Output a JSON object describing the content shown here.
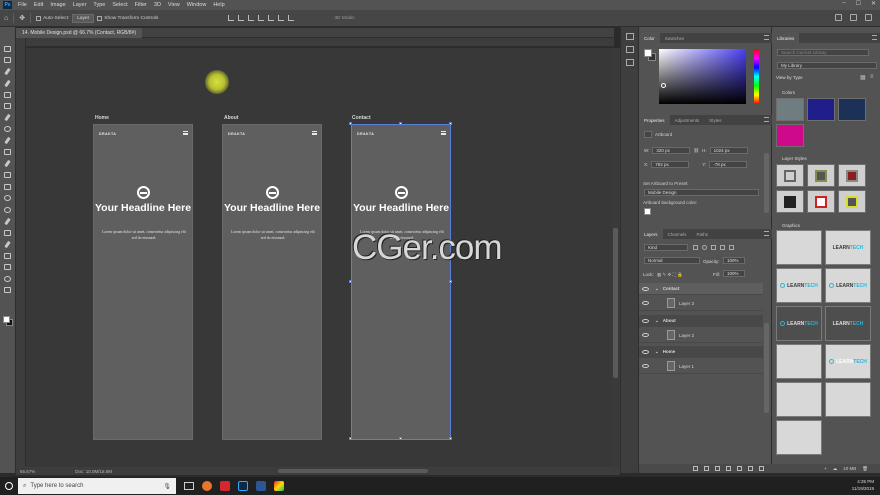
{
  "menubar": {
    "items": [
      "File",
      "Edit",
      "Image",
      "Layer",
      "Type",
      "Select",
      "Filter",
      "3D",
      "View",
      "Window",
      "Help"
    ]
  },
  "options": {
    "auto_select": "Auto-Select:",
    "auto_select_target": "Layer",
    "transform_controls": "Show Transform Controls",
    "mode_3d": "3D Mode:"
  },
  "document": {
    "tab_title": "14. Mobile Design.psd @ 66.7% (Contact, RGB/8#)",
    "zoom": "66.67%",
    "doc_size": "Doc: 10.0M/16.6M"
  },
  "artboards": [
    {
      "title": "Home",
      "brand": "DRAKTA",
      "headline": "Your Headline Here",
      "body": "Lorem ipsum dolor sit amet, consectetur adipiscing elit sed do eiusmod."
    },
    {
      "title": "About",
      "brand": "DRAKTA",
      "headline": "Your Headline Here",
      "body": "Lorem ipsum dolor sit amet, consectetur adipiscing elit sed do eiusmod."
    },
    {
      "title": "Contact",
      "brand": "DRAKTA",
      "headline": "Your Headline Here",
      "body": "Lorem ipsum dolor sit amet, consectetur adipiscing elit sed do eiusmod."
    }
  ],
  "watermark": "CGer.com",
  "color_panel": {
    "tabs": [
      "Color",
      "Swatches"
    ]
  },
  "properties_panel": {
    "tabs": [
      "Properties",
      "Adjustments",
      "Styles"
    ],
    "type_label": "Artboard",
    "w": "320 px",
    "h": "1024 px",
    "x": "792 px",
    "y": "-78 px",
    "w_label": "W:",
    "h_label": "H:",
    "x_label": "X:",
    "y_label": "Y:",
    "go_label": "GO",
    "preset_label": "Set Artboard to Preset:",
    "preset_value": "Mobile Design",
    "bg_label": "Artboard background color:"
  },
  "layers_panel": {
    "tabs": [
      "Layers",
      "Channels",
      "Paths"
    ],
    "kind": "Kind",
    "blend_mode": "Normal",
    "opacity_label": "Opacity:",
    "opacity": "100%",
    "lock_label": "Lock:",
    "fill_label": "Fill:",
    "fill": "100%",
    "groups": [
      {
        "name": "Contact",
        "layer": "Layer 3"
      },
      {
        "name": "About",
        "layer": "Layer 2"
      },
      {
        "name": "Home",
        "layer": "Layer 1"
      }
    ]
  },
  "libraries_panel": {
    "tab": "Libraries",
    "search_placeholder": "Search Current Library",
    "library": "My Library",
    "view_by": "View by Type",
    "colors_label": "Colors",
    "layer_styles_label": "Layer Styles",
    "graphics_label": "Graphics",
    "size": "10 MB",
    "colors": [
      "#6f7c80",
      "#1f1e8a",
      "#1b3157",
      "#cf0a8a"
    ],
    "graphic_brand": "LEARN",
    "graphic_accent": "TECH"
  },
  "taskbar": {
    "search_placeholder": "Type here to search",
    "time": "4:35 PM",
    "date": "11/19/2019"
  }
}
